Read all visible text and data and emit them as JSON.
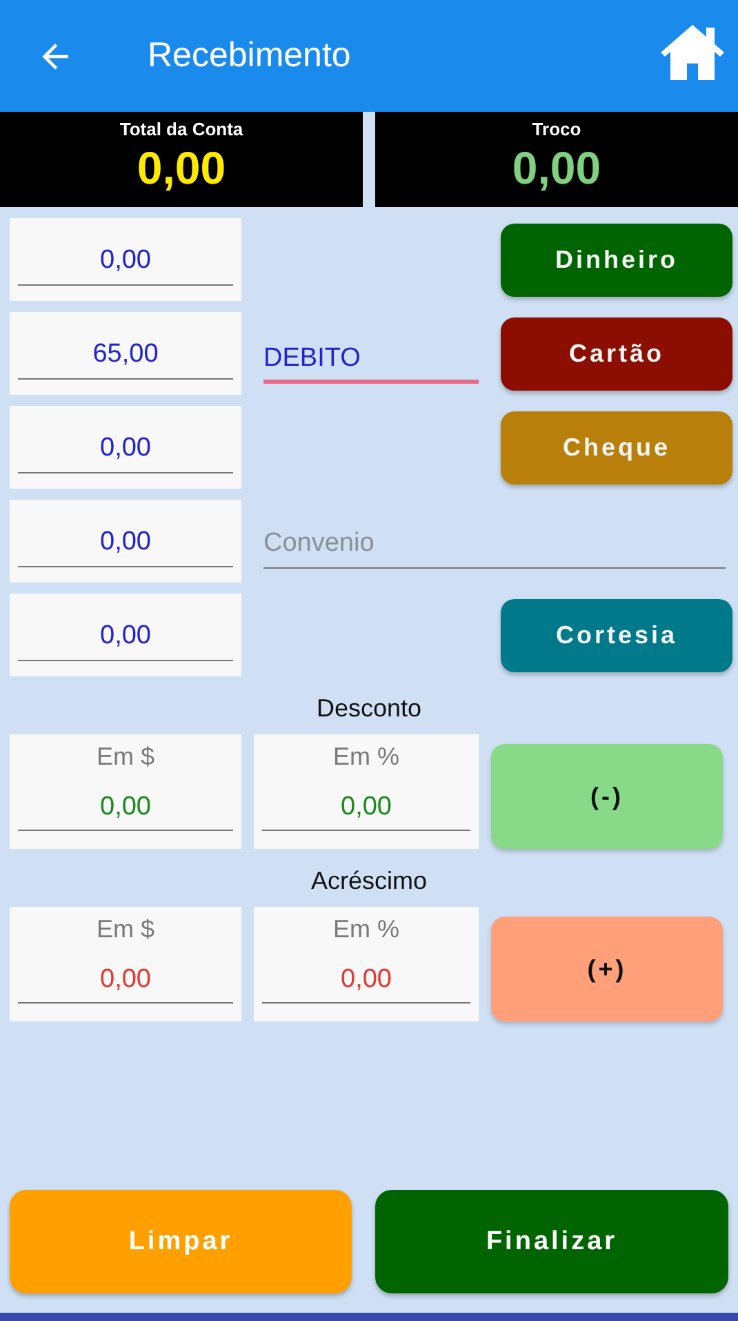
{
  "app_bar": {
    "title": "Recebimento"
  },
  "totals": [
    {
      "label": "Total da Conta",
      "value": "0,00",
      "color": "#ffea00"
    },
    {
      "label": "Troco",
      "value": "0,00",
      "color": "#7fd07f"
    }
  ],
  "payments": [
    {
      "amount": "0,00",
      "middle": {
        "kind": "none"
      },
      "button": {
        "label": "Dinheiro",
        "color": "#006400"
      }
    },
    {
      "amount": "65,00",
      "middle": {
        "kind": "text",
        "value": "DEBITO",
        "focused": true
      },
      "button": {
        "label": "Cartão",
        "color": "#8b0e00"
      }
    },
    {
      "amount": "0,00",
      "middle": {
        "kind": "none"
      },
      "button": {
        "label": "Cheque",
        "color": "#b8800a"
      }
    },
    {
      "amount": "0,00",
      "middle": {
        "kind": "wide",
        "placeholder": "Convenio",
        "focused": false
      }
    },
    {
      "amount": "0,00",
      "middle": {
        "kind": "none"
      },
      "button": {
        "label": "Cortesia",
        "color": "#007a8a"
      }
    }
  ],
  "adjustments": [
    {
      "kind": "discount",
      "title": "Desconto",
      "fields": [
        {
          "label": "Em $",
          "value": "0,00"
        },
        {
          "label": "Em %",
          "value": "0,00"
        }
      ],
      "button": "(-)"
    },
    {
      "kind": "surcharge",
      "title": "Acréscimo",
      "fields": [
        {
          "label": "Em $",
          "value": "0,00"
        },
        {
          "label": "Em %",
          "value": "0,00"
        }
      ],
      "button": "(+)"
    }
  ],
  "actions": [
    {
      "kind": "clear",
      "label": "Limpar"
    },
    {
      "kind": "finish",
      "label": "Finalizar"
    }
  ]
}
